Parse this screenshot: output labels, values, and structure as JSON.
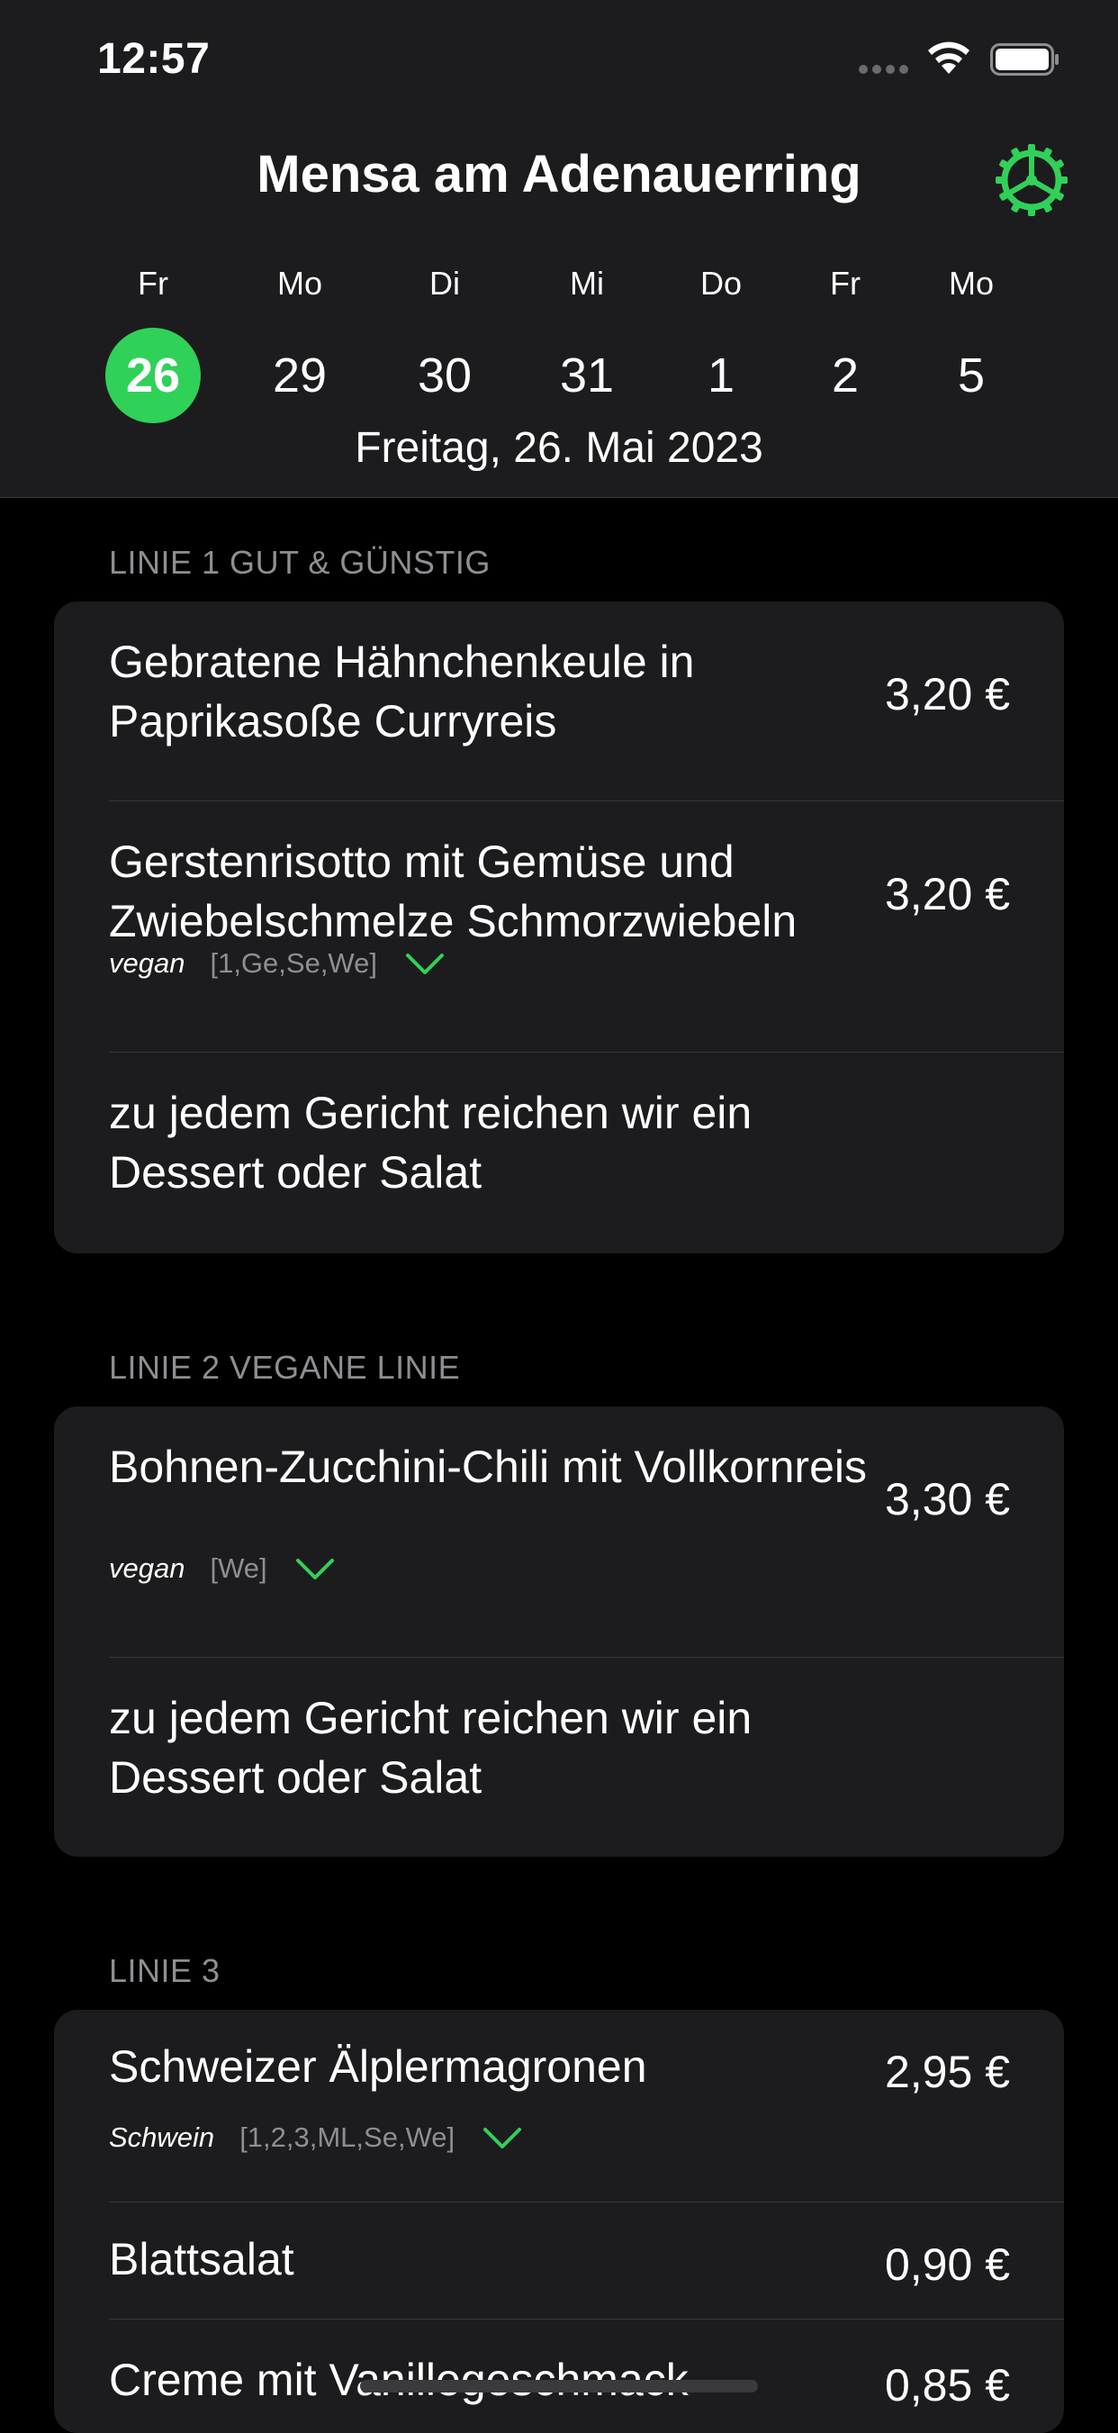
{
  "status_bar": {
    "time": "12:57"
  },
  "header": {
    "title": "Mensa am Adenauerring",
    "date_line": "Freitag, 26. Mai 2023",
    "days": [
      {
        "name": "Fr",
        "num": "26",
        "selected": true
      },
      {
        "name": "Mo",
        "num": "29",
        "selected": false
      },
      {
        "name": "Di",
        "num": "30",
        "selected": false
      },
      {
        "name": "Mi",
        "num": "31",
        "selected": false
      },
      {
        "name": "Do",
        "num": "1",
        "selected": false
      },
      {
        "name": "Fr",
        "num": "2",
        "selected": false
      },
      {
        "name": "Mo",
        "num": "5",
        "selected": false
      }
    ]
  },
  "sections": [
    {
      "title": "LINIE 1 GUT & GÜNSTIG",
      "items": [
        {
          "name": "Gebratene Hähnchenkeule in Paprikasoße Curryreis",
          "price": "3,20 €"
        },
        {
          "name": "Gerstenrisotto mit Gemüse und Zwiebelschmelze Schmorzwiebeln",
          "price": "3,20 €",
          "diet": "vegan",
          "allergens": "[1,Ge,Se,We]"
        },
        {
          "name": "zu jedem Gericht reichen wir ein Dessert oder Salat"
        }
      ]
    },
    {
      "title": "LINIE 2 VEGANE LINIE",
      "items": [
        {
          "name": "Bohnen-Zucchini-Chili mit Vollkornreis",
          "price": "3,30 €",
          "diet": "vegan",
          "allergens": "[We]"
        },
        {
          "name": "zu jedem Gericht reichen wir ein Dessert oder Salat"
        }
      ]
    },
    {
      "title": "LINIE 3",
      "items": [
        {
          "name": "Schweizer Älplermagronen",
          "price": "2,95 €",
          "diet": "Schwein",
          "allergens": "[1,2,3,ML,Se,We]"
        },
        {
          "name": "Blattsalat",
          "price": "0,90 €"
        },
        {
          "name": "Creme mit Vanillegeschmack",
          "price": "0,85 €"
        }
      ]
    }
  ],
  "colors": {
    "accent": "#30d158",
    "background": "#000000",
    "card": "#1c1c1e",
    "secondary_text": "#8e8e93"
  }
}
